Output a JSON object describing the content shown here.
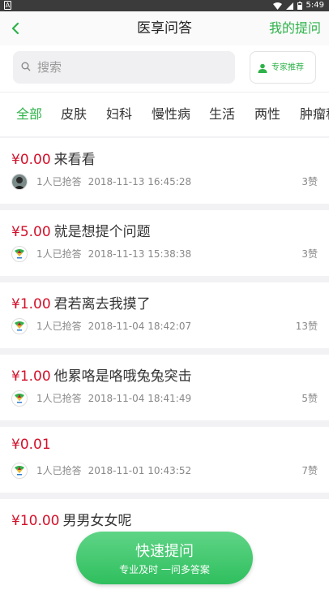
{
  "status_bar": {
    "time": "5:49"
  },
  "header": {
    "title": "医享问答",
    "right_link": "我的提问"
  },
  "search": {
    "placeholder": "搜索",
    "expert_button": "专家推荐"
  },
  "tabs": [
    "全部",
    "皮肤",
    "妇科",
    "慢性病",
    "生活",
    "两性",
    "肿瘤科"
  ],
  "questions": [
    {
      "price": "¥0.00",
      "title": "来看看",
      "answered": "1人已抢答",
      "time": "2018-11-13 16:45:28",
      "likes": "3赞",
      "avatar": "photo"
    },
    {
      "price": "¥5.00",
      "title": "就是想提个问题",
      "answered": "1人已抢答",
      "time": "2018-11-13 15:38:38",
      "likes": "3赞",
      "avatar": "logo"
    },
    {
      "price": "¥1.00",
      "title": "君若离去我摸了",
      "answered": "1人已抢答",
      "time": "2018-11-04 18:42:07",
      "likes": "13赞",
      "avatar": "logo"
    },
    {
      "price": "¥1.00",
      "title": "他累咯是咯哦兔兔突击",
      "answered": "1人已抢答",
      "time": "2018-11-04 18:41:49",
      "likes": "5赞",
      "avatar": "logo"
    },
    {
      "price": "¥0.01",
      "title": "",
      "answered": "1人已抢答",
      "time": "2018-11-01 10:43:52",
      "likes": "7赞",
      "avatar": "logo"
    },
    {
      "price": "¥10.00",
      "title": "男男女女呢",
      "answered": "",
      "time": "",
      "likes": "",
      "avatar": ""
    }
  ],
  "quick_ask": {
    "label": "快速提问",
    "sub": "专业及时 一问多答案"
  },
  "colors": {
    "accent": "#2fb24a",
    "price": "#d2112a"
  }
}
